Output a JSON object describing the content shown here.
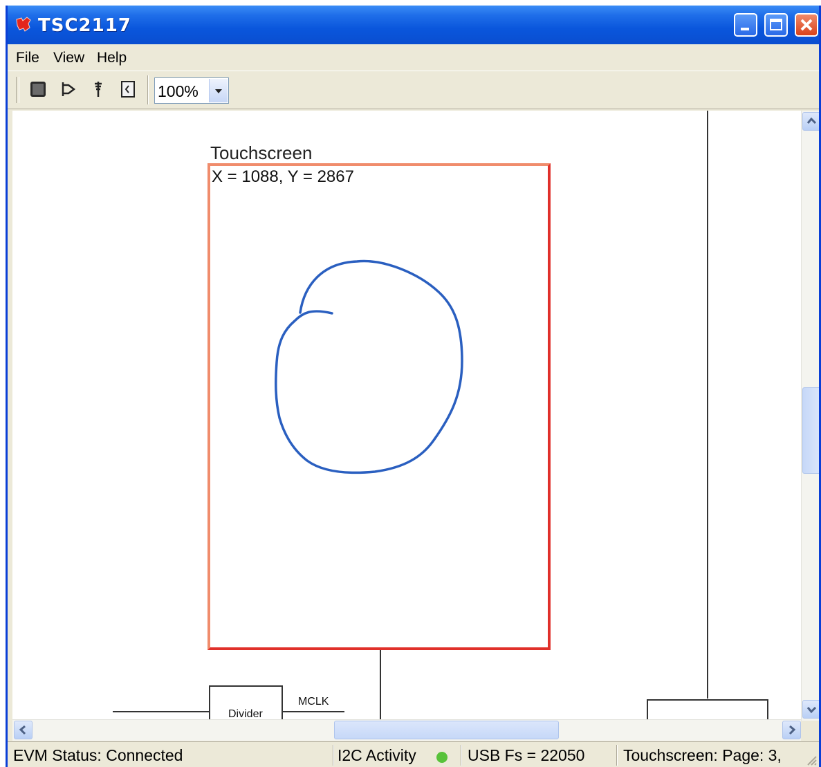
{
  "window": {
    "title": "TSC2117"
  },
  "menu": {
    "file": "File",
    "view": "View",
    "help": "Help"
  },
  "toolbar": {
    "icons": [
      "chip-icon",
      "speaker-icon",
      "microphone-icon",
      "keypad-icon"
    ],
    "zoom": "100%"
  },
  "canvas": {
    "touchscreen_title": "Touchscreen",
    "coordinates": "X = 1088, Y = 2867",
    "divider_label": "Divider",
    "mclk_label": "MCLK"
  },
  "status": {
    "evm": "EVM Status: Connected",
    "i2c": "I2C Activity",
    "usb": "USB Fs = 22050",
    "page": "Touchscreen: Page: 3,"
  },
  "colors": {
    "touch_border": "#e0302a",
    "stroke": "#2a5fc0",
    "titlebar": "#0a56dc",
    "led": "#58c23a"
  }
}
